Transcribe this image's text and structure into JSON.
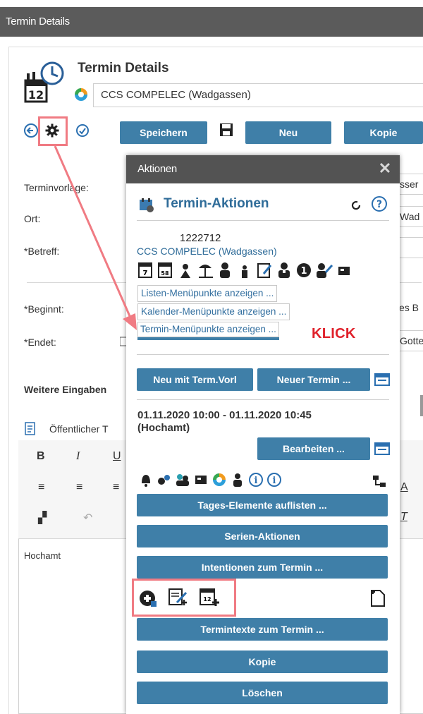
{
  "window": {
    "title": "Termin Details"
  },
  "header": {
    "title": "Termin Details",
    "organisation": "CCS COMPELEC (Wadgassen)"
  },
  "toolbar": {
    "save_label": "Speichern",
    "new_label": "Neu",
    "copy_label": "Kopie"
  },
  "form": {
    "labels": {
      "vorlage": "Terminvorlage:",
      "ort": "Ort:",
      "betreff": "*Betreff:",
      "beginnt": "*Beginnt:",
      "endet": "*Endet:",
      "weitere": "Weitere Eingaben"
    },
    "right_values": {
      "vorlage": "sser",
      "ort": "Wad",
      "beginnt": "es B",
      "endet": "Gotte"
    }
  },
  "editor": {
    "section_label": "Öffentlicher T",
    "body_text": "Hochamt"
  },
  "dialog": {
    "title": "Aktionen",
    "section_title": "Termin-Aktionen",
    "id_number": "1222712",
    "organisation_link": "CCS COMPELEC (Wadgassen)",
    "menu_links": [
      "Listen-Menüpunkte anzeigen ...",
      "Kalender-Menüpunkte anzeigen ...",
      "Termin-Menüpunkte anzeigen ..."
    ],
    "annotation": "KLICK",
    "new_with_template": "Neu mit Term.Vorl",
    "new_appointment": "Neuer Termin ...",
    "date_line1": "01.11.2020 10:00 - 01.11.2020 10:45",
    "date_line2": "(Hochamt)",
    "edit_label": "Bearbeiten ...",
    "buttons": {
      "list_elements": "Tages-Elemente auflisten ...",
      "series": "Serien-Aktionen",
      "intentions": "Intentionen zum Termin ...",
      "texts": "Termintexte zum Termin ...",
      "copy": "Kopie",
      "delete": "Löschen"
    }
  },
  "colors": {
    "accent": "#3f7fa8",
    "link": "#2f6c99",
    "highlight": "#f07b83",
    "annotation": "#e0212b"
  }
}
